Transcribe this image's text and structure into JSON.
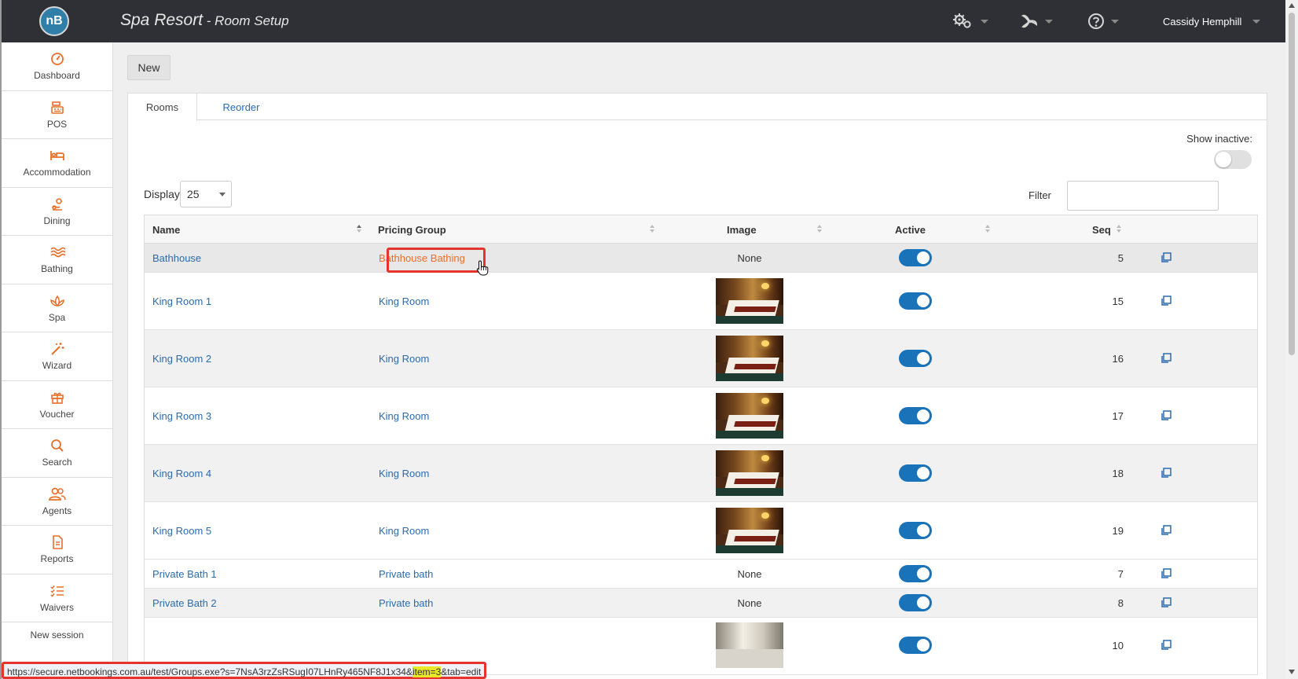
{
  "header": {
    "logo": "nB",
    "title": "Spa Resort",
    "separator": " - ",
    "subtitle": "Room Setup",
    "user": "Cassidy Hemphill",
    "icons": [
      "gears-icon",
      "spinner-icon",
      "help-icon"
    ]
  },
  "sidebar": {
    "items": [
      {
        "label": "Dashboard",
        "icon": "dashboard-icon"
      },
      {
        "label": "POS",
        "icon": "register-icon"
      },
      {
        "label": "Accommodation",
        "icon": "bed-icon"
      },
      {
        "label": "Dining",
        "icon": "dining-icon"
      },
      {
        "label": "Bathing",
        "icon": "waves-icon"
      },
      {
        "label": "Spa",
        "icon": "lotus-icon"
      },
      {
        "label": "Wizard",
        "icon": "wand-icon"
      },
      {
        "label": "Voucher",
        "icon": "gift-icon"
      },
      {
        "label": "Search",
        "icon": "search-icon"
      },
      {
        "label": "Agents",
        "icon": "agents-icon"
      },
      {
        "label": "Reports",
        "icon": "report-icon"
      },
      {
        "label": "Waivers",
        "icon": "checklist-icon"
      }
    ],
    "new_session": "New session"
  },
  "toolbar": {
    "new_label": "New"
  },
  "tabs": [
    {
      "label": "Rooms",
      "active": true
    },
    {
      "label": "Reorder",
      "active": false
    }
  ],
  "show_inactive": {
    "label": "Show inactive:",
    "on": false
  },
  "display": {
    "label": "Display",
    "value": "25"
  },
  "filter": {
    "label": "Filter",
    "value": "",
    "placeholder": ""
  },
  "table": {
    "columns": [
      "Name",
      "Pricing Group",
      "Image",
      "Active",
      "Seq"
    ],
    "rows": [
      {
        "name": "Bathhouse",
        "group": "Bathhouse Bathing",
        "image": "None",
        "active": true,
        "seq": "5"
      },
      {
        "name": "King Room 1",
        "group": "King Room",
        "image": "photo",
        "active": true,
        "seq": "15"
      },
      {
        "name": "King Room 2",
        "group": "King Room",
        "image": "photo",
        "active": true,
        "seq": "16"
      },
      {
        "name": "King Room 3",
        "group": "King Room",
        "image": "photo",
        "active": true,
        "seq": "17"
      },
      {
        "name": "King Room 4",
        "group": "King Room",
        "image": "photo",
        "active": true,
        "seq": "18"
      },
      {
        "name": "King Room 5",
        "group": "King Room",
        "image": "photo",
        "active": true,
        "seq": "19"
      },
      {
        "name": "Private Bath 1",
        "group": "Private bath",
        "image": "None",
        "active": true,
        "seq": "7"
      },
      {
        "name": "Private Bath 2",
        "group": "Private bath",
        "image": "None",
        "active": true,
        "seq": "8"
      },
      {
        "name": "",
        "group": "",
        "image": "photo",
        "active": true,
        "seq": "10"
      }
    ]
  },
  "status_bar": {
    "url_before": "https://secure.netbookings.com.au/test/Groups.exe?s=7NsA3rzZsRSugI07LHnRy465NF8J1x34&",
    "url_highlight": "item=3",
    "url_after": "&tab=edit"
  },
  "colors": {
    "accent": "#e8702a",
    "link": "#2a6bb0",
    "toggle": "#1a72b8",
    "topbar": "#2f3036",
    "highlight_box": "#e5342e"
  }
}
